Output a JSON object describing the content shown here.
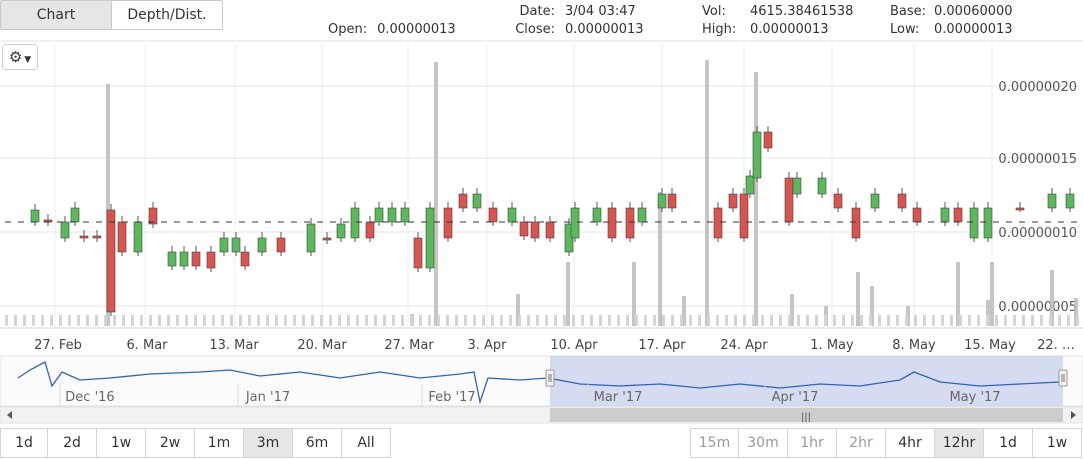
{
  "tabs": [
    "Chart",
    "Depth/Dist."
  ],
  "ohlc": {
    "open_label": "Open:",
    "open": "0.00000013",
    "date_label": "Date:",
    "date": "3/04 03:47",
    "close_label": "Close:",
    "close": "0.00000013",
    "vol_label": "Vol:",
    "vol": "4615.38461538",
    "high_label": "High:",
    "high": "0.00000013",
    "base_label": "Base:",
    "base": "0.00060000",
    "low_label": "Low:",
    "low": "0.00000013"
  },
  "settings_icon": "gear-icon",
  "ranges": [
    "1d",
    "2d",
    "1w",
    "2w",
    "1m",
    "3m",
    "6m",
    "All"
  ],
  "range_selected": "3m",
  "intervals": [
    "15m",
    "30m",
    "1hr",
    "2hr",
    "4hr",
    "12hr",
    "1d",
    "1w"
  ],
  "interval_selected": "12hr",
  "intervals_enabled": [
    "4hr",
    "12hr",
    "1d",
    "1w"
  ],
  "colors": {
    "up": "#5cb85c",
    "down": "#d9534f",
    "volume": "#bbbbbb",
    "navigator_line": "#3060c0",
    "navigator_mask": "#c8d2ee"
  },
  "chart_data": {
    "type": "candlestick",
    "y_ticks": [
      "0.00000005",
      "0.00000010",
      "0.00000015",
      "0.00000020"
    ],
    "x_ticks": [
      "27. Feb",
      "6. Mar",
      "13. Mar",
      "20. Mar",
      "27. Mar",
      "3. Apr",
      "10. Apr",
      "17. Apr",
      "24. Apr",
      "1. May",
      "8. May",
      "15. May",
      "22. …"
    ],
    "navigator_ticks": [
      "Dec '16",
      "Jan '17",
      "Feb '17",
      "Mar '17",
      "Apr '17",
      "May '17"
    ],
    "grid": true
  }
}
